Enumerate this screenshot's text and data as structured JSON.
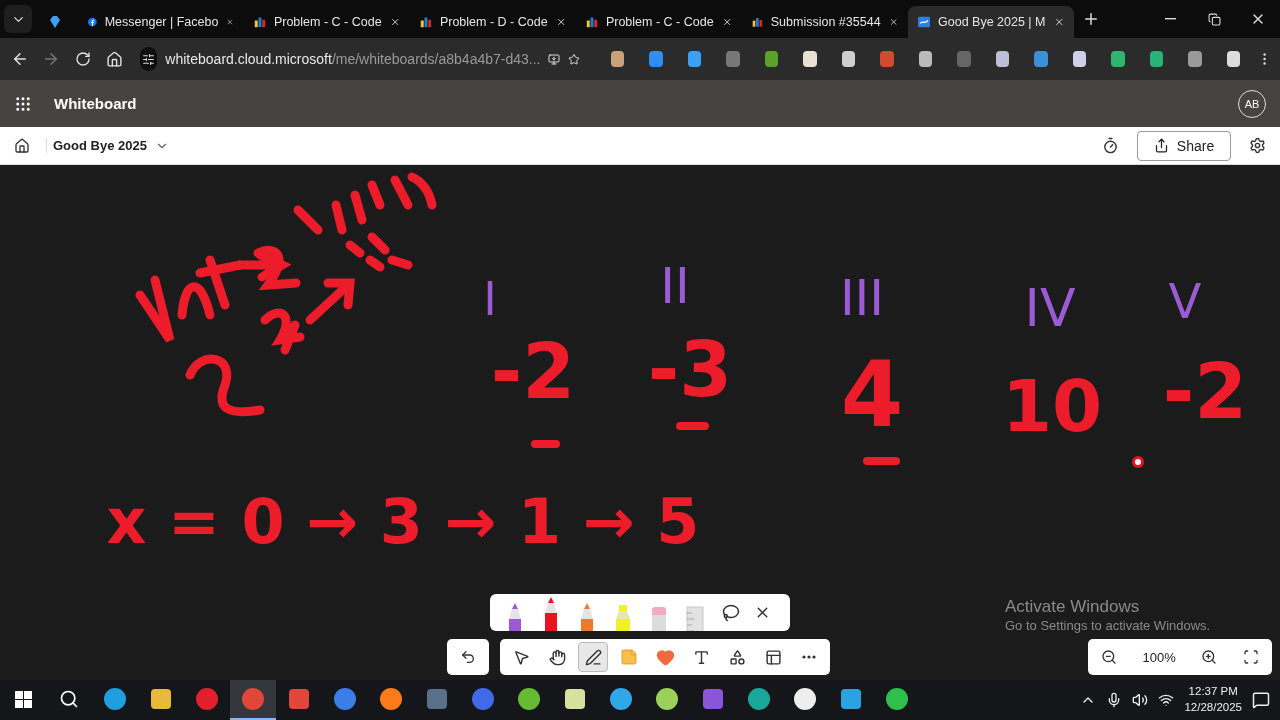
{
  "browser": {
    "tabs": [
      {
        "selected": false
      },
      {
        "title": "Messenger | Facebo",
        "selected": false
      },
      {
        "title": "Problem - C - Code",
        "selected": false
      },
      {
        "title": "Problem - D - Code",
        "selected": false
      },
      {
        "title": "Problem - C - Code",
        "selected": false
      },
      {
        "title": "Submission #35544",
        "selected": false
      },
      {
        "title": "Good Bye 2025 | M",
        "selected": true
      }
    ],
    "address": {
      "host": "whiteboard.cloud.microsoft",
      "path": "/me/whiteboards/a8b4a4b7-d43..."
    }
  },
  "app_header": {
    "title": "Whiteboard",
    "avatar": "AB"
  },
  "board_bar": {
    "board_name": "Good Bye 2025",
    "share_label": "Share"
  },
  "canvas": {
    "ink": [
      {
        "text": "I",
        "color": "#9b5bd4"
      },
      {
        "text": "II",
        "color": "#9b5bd4"
      },
      {
        "text": "III",
        "color": "#9b5bd4"
      },
      {
        "text": "IV",
        "color": "#9b5bd4"
      },
      {
        "text": "V",
        "color": "#9b5bd4"
      },
      {
        "text": "-2",
        "color": "#ec1c2a"
      },
      {
        "text": "-3",
        "color": "#ec1c2a"
      },
      {
        "text": "4",
        "color": "#ec1c2a"
      },
      {
        "text": "10",
        "color": "#ec1c2a"
      },
      {
        "text": "-2",
        "color": "#ec1c2a"
      },
      {
        "text": "x = 0 → 3 → 1 → 5",
        "color": "#ec1c2a"
      }
    ]
  },
  "pen_tray": {
    "tools": [
      {
        "kind": "pen",
        "color": "#9b59d6",
        "selected": false
      },
      {
        "kind": "pen",
        "color": "#e8141f",
        "selected": true
      },
      {
        "kind": "pen",
        "color": "#f07a28",
        "selected": false
      },
      {
        "kind": "highlighter",
        "color": "#f2f21c",
        "selected": false
      },
      {
        "kind": "eraser",
        "selected": false
      },
      {
        "kind": "ruler",
        "selected": false
      }
    ]
  },
  "toolbar": {
    "tools": [
      {
        "kind": "select",
        "selected": false
      },
      {
        "kind": "hand",
        "selected": false
      },
      {
        "kind": "ink",
        "selected": true
      },
      {
        "kind": "note",
        "selected": false
      },
      {
        "kind": "reaction",
        "selected": false
      },
      {
        "kind": "text",
        "selected": false
      },
      {
        "kind": "shapes",
        "selected": false
      },
      {
        "kind": "template",
        "selected": false
      },
      {
        "kind": "more",
        "selected": false
      }
    ]
  },
  "zoom": {
    "value": "100%"
  },
  "activation_notice": {
    "title": "Activate Windows",
    "subtitle": "Go to Settings to activate Windows."
  },
  "taskbar": {
    "apps": [
      {
        "selected": false
      },
      {
        "selected": false
      },
      {
        "selected": false
      },
      {
        "selected": true
      },
      {
        "selected": false
      },
      {
        "selected": false
      },
      {
        "selected": false
      },
      {
        "selected": false
      },
      {
        "selected": false
      },
      {
        "selected": false
      },
      {
        "selected": false
      },
      {
        "selected": false
      },
      {
        "selected": false
      },
      {
        "selected": false
      },
      {
        "selected": false
      },
      {
        "selected": false
      },
      {
        "selected": false
      },
      {
        "selected": false
      }
    ],
    "time": "12:37 PM",
    "date": "12/28/2025"
  }
}
